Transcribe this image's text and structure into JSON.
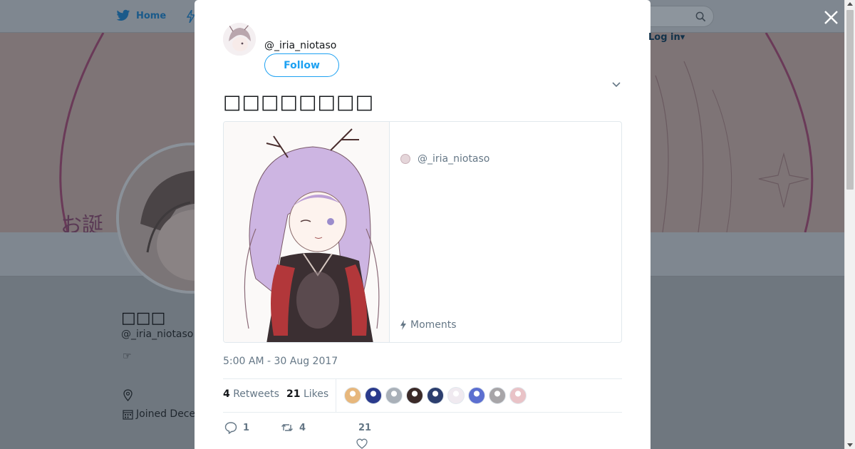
{
  "nav": {
    "home_label": "Home",
    "login_label": "Log in▾"
  },
  "profile": {
    "name": "□□□",
    "handle": "@_iria_niotaso",
    "bio_glyph": "☞",
    "joined_text": "Joined Dece",
    "banner_text": "お誕"
  },
  "tweet": {
    "author_handle": "@_iria_niotaso",
    "follow_label": "Follow",
    "text": "□□□□□□□□",
    "card": {
      "author_handle": "@_iria_niotaso",
      "footer_label": "Moments"
    },
    "timestamp": "5:00 AM - 30 Aug 2017",
    "retweets_count": "4",
    "retweets_label": "Retweets",
    "likes_count": "21",
    "likes_label": "Likes",
    "likers": [
      {
        "icon": "liker-avatar",
        "color": "#e7b77c"
      },
      {
        "icon": "liker-avatar",
        "color": "#2a3a8c"
      },
      {
        "icon": "liker-avatar",
        "color": "#a9b0b8"
      },
      {
        "icon": "liker-avatar",
        "color": "#3b2a28"
      },
      {
        "icon": "liker-avatar",
        "color": "#2c3e6e"
      },
      {
        "icon": "liker-avatar",
        "color": "#f0eaf0"
      },
      {
        "icon": "liker-avatar",
        "color": "#5c6fd0"
      },
      {
        "icon": "liker-avatar",
        "color": "#a7a5a8"
      },
      {
        "icon": "liker-avatar",
        "color": "#e9c3c7"
      }
    ],
    "actions": {
      "reply_count": "1",
      "retweet_count": "4",
      "like_count": "21"
    }
  },
  "colors": {
    "accent": "#1da1f2",
    "muted_text": "#657786",
    "overlay_gray": "#7f8790"
  }
}
